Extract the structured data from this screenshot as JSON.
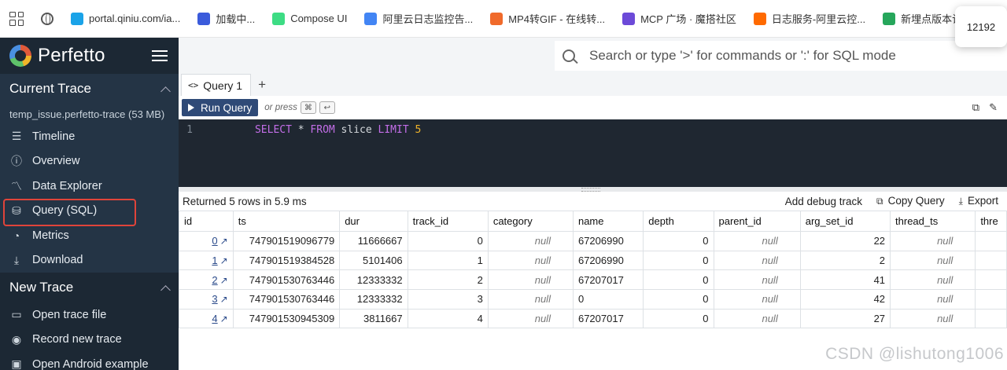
{
  "bookmarks": {
    "items": [
      {
        "label": "portal.qiniu.com/ia...",
        "color": "#1aa3e8"
      },
      {
        "label": "加载中...",
        "color": "#3b5bdb"
      },
      {
        "label": "Compose UI",
        "color": "#3ddc84"
      },
      {
        "label": "阿里云日志监控告...",
        "color": "#4285f4"
      },
      {
        "label": "MP4转GIF - 在线转...",
        "color": "#f06a2b"
      },
      {
        "label": "MCP 广场 · 魔搭社区",
        "color": "#6c4ad8"
      },
      {
        "label": "日志服务-阿里云控...",
        "color": "#ff6a00"
      },
      {
        "label": "新埋点版本记录 -...",
        "color": "#26a65b"
      }
    ],
    "popup_text": "12192"
  },
  "sidebar": {
    "brand": "Perfetto",
    "current_trace": {
      "title": "Current Trace",
      "trace_name": "temp_issue.perfetto-trace (53 MB)",
      "items": [
        {
          "label": "Timeline",
          "icon": "timeline-icon"
        },
        {
          "label": "Overview",
          "icon": "info-icon"
        },
        {
          "label": "Data Explorer",
          "icon": "chart-icon"
        },
        {
          "label": "Query (SQL)",
          "icon": "database-icon"
        },
        {
          "label": "Metrics",
          "icon": "speed-icon"
        },
        {
          "label": "Download",
          "icon": "download-icon"
        }
      ]
    },
    "new_trace": {
      "title": "New Trace",
      "items": [
        {
          "label": "Open trace file",
          "icon": "folder-icon"
        },
        {
          "label": "Record new trace",
          "icon": "record-icon"
        },
        {
          "label": "Open Android example",
          "icon": "android-icon"
        }
      ]
    }
  },
  "search": {
    "placeholder": "Search or type '>' for commands or ':' for SQL mode"
  },
  "query": {
    "tab_label": "Query 1",
    "tab_code_icon": "<>",
    "add_tab": "+",
    "run_label": "Run Query",
    "or_press": "or press",
    "key_cmd": "⌘",
    "key_enter": "↩",
    "editor": {
      "line_no": "1",
      "kw1": "SELECT",
      "star": " * ",
      "kw2": "FROM",
      "ident": " slice ",
      "kw3": "LIMIT",
      "num": " 5"
    }
  },
  "results": {
    "status": "Returned 5 rows in 5.9 ms",
    "add_debug": "Add debug track",
    "copy_query": "Copy Query",
    "export": "Export",
    "columns": [
      "id",
      "ts",
      "dur",
      "track_id",
      "category",
      "name",
      "depth",
      "parent_id",
      "arg_set_id",
      "thread_ts",
      "thre"
    ],
    "rows": [
      [
        "0",
        "747901519096779",
        "11666667",
        "0",
        "null",
        "67206990",
        "0",
        "null",
        "22",
        "null"
      ],
      [
        "1",
        "747901519384528",
        "5101406",
        "1",
        "null",
        "67206990",
        "0",
        "null",
        "2",
        "null"
      ],
      [
        "2",
        "747901530763446",
        "12333332",
        "2",
        "null",
        "67207017",
        "0",
        "null",
        "41",
        "null"
      ],
      [
        "3",
        "747901530763446",
        "12333332",
        "3",
        "null",
        "0",
        "0",
        "null",
        "42",
        "null"
      ],
      [
        "4",
        "747901530945309",
        "3811667",
        "4",
        "null",
        "67207017",
        "0",
        "null",
        "27",
        "null"
      ]
    ]
  },
  "watermark": "CSDN @lishutong1006"
}
